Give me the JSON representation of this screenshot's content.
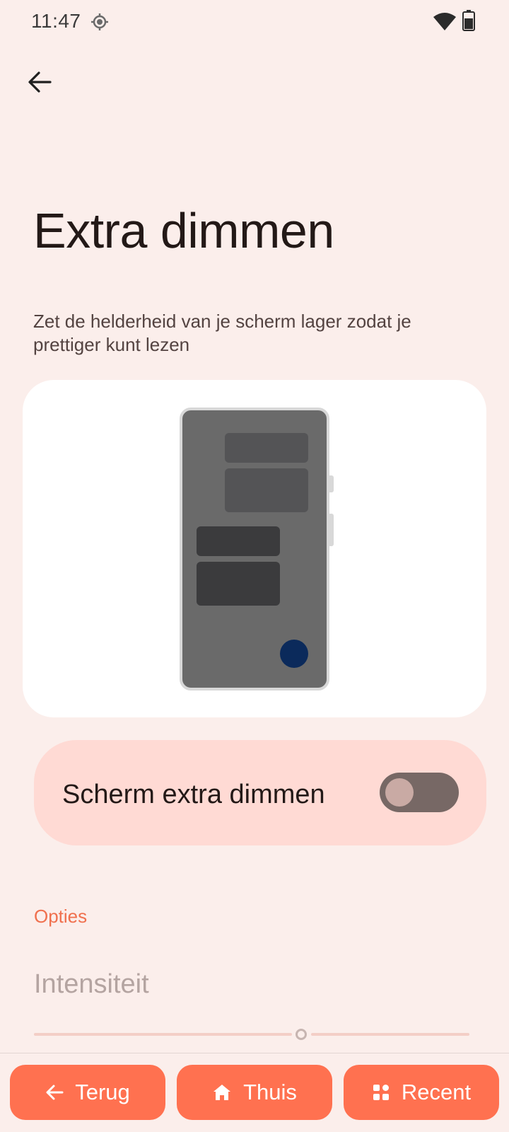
{
  "status_bar": {
    "time": "11:47",
    "icons": [
      "location-icon",
      "wifi-icon",
      "battery-icon"
    ]
  },
  "header": {
    "back_icon": "arrow-left-icon"
  },
  "page": {
    "title": "Extra dimmen",
    "description": "Zet de helderheid van je scherm lager zodat je prettiger kunt lezen"
  },
  "main_toggle": {
    "label": "Scherm extra dimmen",
    "checked": false
  },
  "options": {
    "section_title": "Opties",
    "intensity_label": "Intensiteit",
    "intensity_value": 0.6,
    "enabled": false
  },
  "bottom_nav": {
    "back_label": "Terug",
    "home_label": "Thuis",
    "recent_label": "Recent"
  },
  "colors": {
    "background": "#fbeeeb",
    "accent": "#ff7150",
    "section_header": "#f0704e",
    "toggle_card": "#ffdad4",
    "switch_off": "#776865"
  }
}
